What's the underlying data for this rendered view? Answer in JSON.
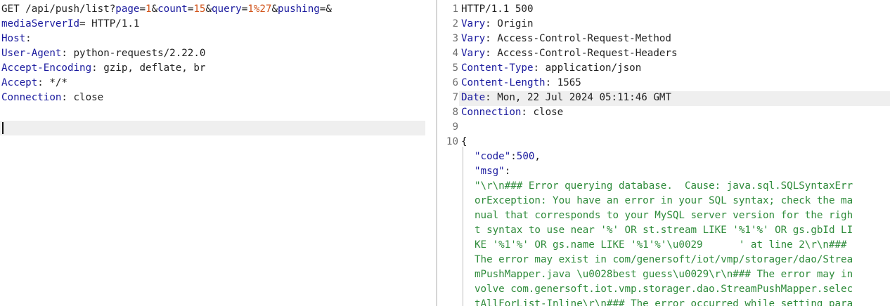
{
  "request": {
    "request_line": {
      "method_path": "GET /api/push/list?",
      "params": [
        {
          "key": "page",
          "value": "1",
          "sep": "&"
        },
        {
          "key": "count",
          "value": "15",
          "sep": "&"
        },
        {
          "key": "query",
          "value": "1%27",
          "sep": "&"
        },
        {
          "key": "pushing",
          "value": "",
          "sep": "&"
        }
      ],
      "continuation_key": "mediaServerId",
      "continuation_rest": "= HTTP/1.1"
    },
    "headers": [
      {
        "name": "Host",
        "value": ""
      },
      {
        "name": "User-Agent",
        "value": "python-requests/2.22.0"
      },
      {
        "name": "Accept-Encoding",
        "value": "gzip, deflate, br"
      },
      {
        "name": "Accept",
        "value": "*/*"
      },
      {
        "name": "Connection",
        "value": "close"
      }
    ]
  },
  "response": {
    "status_line": "HTTP/1.1 500",
    "headers": [
      {
        "name": "Vary",
        "value": "Origin"
      },
      {
        "name": "Vary",
        "value": "Access-Control-Request-Method"
      },
      {
        "name": "Vary",
        "value": "Access-Control-Request-Headers"
      },
      {
        "name": "Content-Type",
        "value": "application/json"
      },
      {
        "name": "Content-Length",
        "value": "1565"
      },
      {
        "name": "Date",
        "value": "Mon, 22 Jul 2024 05:11:46 GMT"
      },
      {
        "name": "Connection",
        "value": "close"
      }
    ],
    "line_numbers": [
      "1",
      "2",
      "3",
      "4",
      "5",
      "6",
      "7",
      "8",
      "9",
      "10"
    ],
    "body_open": "{",
    "code_key": "\"code\"",
    "code_value": "500",
    "msg_key": "\"msg\"",
    "msg_lines": [
      "\"\\r\\n### Error querying database.  Cause: java.sql.SQLSyntaxErr",
      "orException: You have an error in your SQL syntax; check the ma",
      "nual that corresponds to your MySQL server version for the righ",
      "t syntax to use near '%' OR st.stream LIKE '%1'%' OR gs.gbId LI",
      "KE '%1'%' OR gs.name LIKE '%1'%'\\u0029      ' at line 2\\r\\n###",
      "The error may exist in com/genersoft/iot/vmp/storager/dao/Strea",
      "mPushMapper.java \\u0028best guess\\u0029\\r\\n### The error may in",
      "volve com.genersoft.iot.vmp.storager.dao.StreamPushMapper.selec",
      "tAllForList-Inline\\r\\n### The error occurred while setting para"
    ]
  }
}
